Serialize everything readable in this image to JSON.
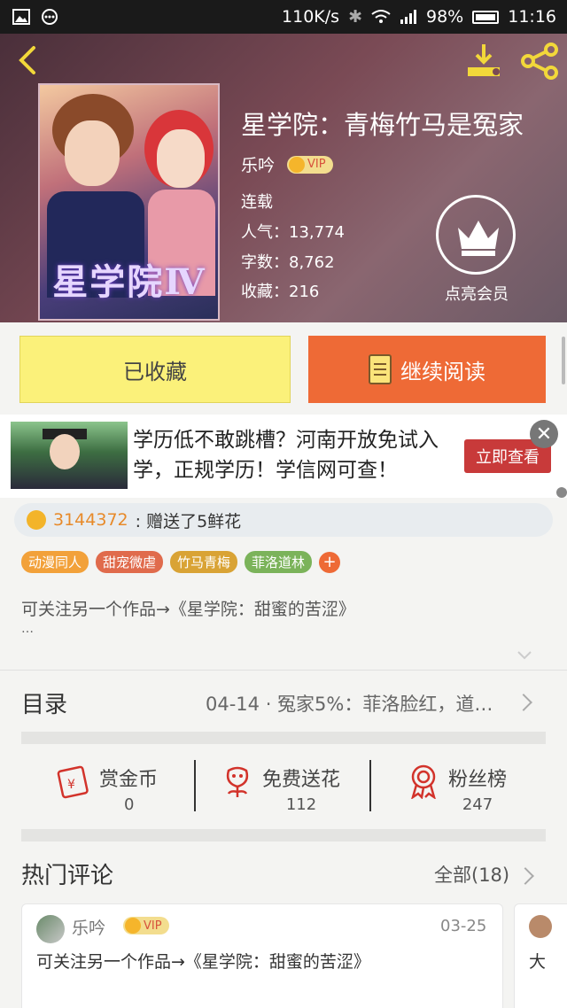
{
  "status_bar": {
    "speed": "110K/s",
    "battery": "98%",
    "time": "11:16"
  },
  "book": {
    "title": "星学院：青梅竹马是冤家",
    "author": "乐吟",
    "vip_label": "VIP",
    "status": "连载",
    "popularity": "人气：13,774",
    "word_count": "字数：8,762",
    "collections": "收藏：216",
    "cover_title": "星学院Ⅳ",
    "member_label": "点亮会员"
  },
  "actions": {
    "favorited_label": "已收藏",
    "continue_label": "继续阅读"
  },
  "ad": {
    "text": "学历低不敢跳槽？河南开放免试入学，正规学历！学信网可查！",
    "cta": "立即查看",
    "close": "✕"
  },
  "gift": {
    "user": "3144372",
    "text": ": 赠送了5鲜花"
  },
  "tags": [
    {
      "label": "动漫同人",
      "color": "#f2a13a"
    },
    {
      "label": "甜宠微虐",
      "color": "#e06b4c"
    },
    {
      "label": "竹马青梅",
      "color": "#d9a335"
    },
    {
      "label": "菲洛道林",
      "color": "#7bb35a"
    }
  ],
  "intro": {
    "text": "可关注另一个作品→《星学院：甜蜜的苦涩》",
    "more": "…"
  },
  "toc": {
    "label": "目录",
    "latest": "04-14 · 冤家5%：菲洛脸红，道…"
  },
  "stats": [
    {
      "label": "赏金币",
      "value": "0",
      "icon": "red-envelope-icon"
    },
    {
      "label": "免费送花",
      "value": "112",
      "icon": "flower-icon"
    },
    {
      "label": "粉丝榜",
      "value": "247",
      "icon": "medal-icon"
    }
  ],
  "comments": {
    "title": "热门评论",
    "all_label": "全部(18)",
    "items": [
      {
        "user": "乐吟",
        "vip": "VIP",
        "date": "03-25",
        "text": "可关注另一个作品→《星学院：甜蜜的苦涩》"
      },
      {
        "text": "大"
      }
    ]
  },
  "colors": {
    "accent": "#ee6a36",
    "favorite_bg": "#fbf17a"
  }
}
